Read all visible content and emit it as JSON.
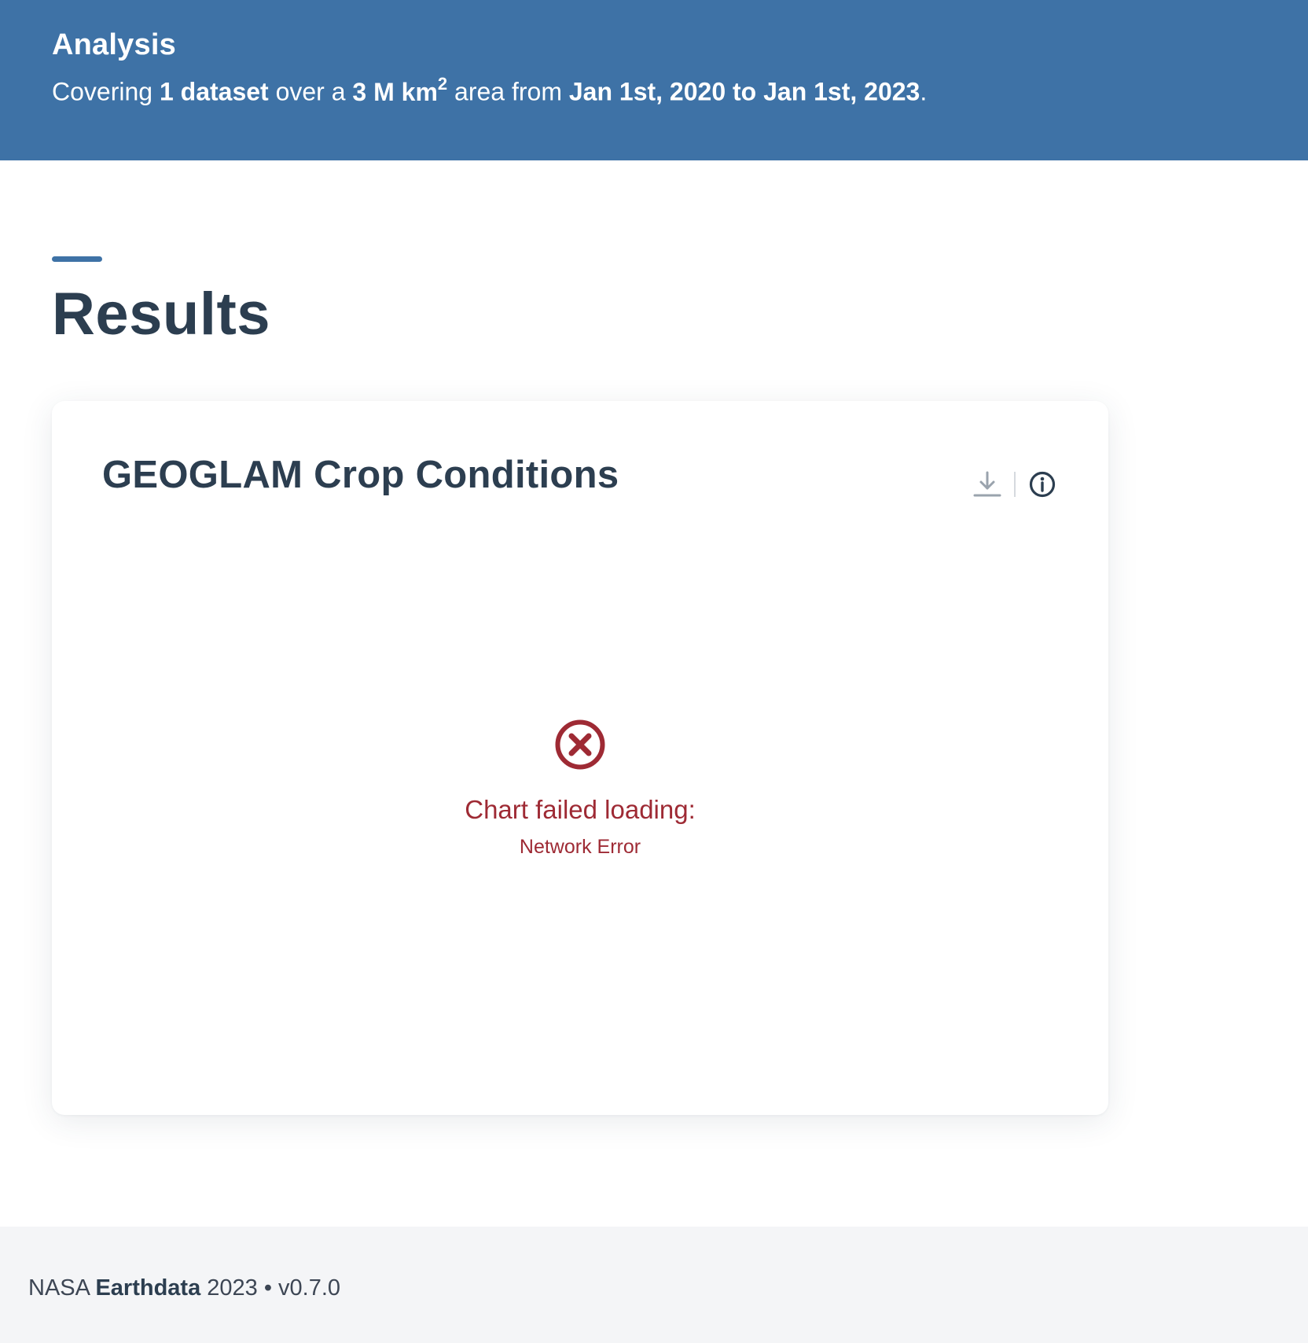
{
  "header": {
    "title": "Analysis",
    "subtitle": {
      "prefix": "Covering ",
      "datasets": "1 dataset",
      "mid1": " over a ",
      "area": "3 M km",
      "area_exp": "2",
      "mid2": " area from ",
      "date_range": "Jan 1st, 2020 to Jan 1st, 2023",
      "suffix": "."
    },
    "background_color": "#3e72a6"
  },
  "results": {
    "heading": "Results"
  },
  "card": {
    "title": "GEOGLAM Crop Conditions",
    "actions": {
      "download_icon": "download-icon",
      "info_icon": "info-icon"
    },
    "error": {
      "icon": "error-circle-x-icon",
      "message": "Chart failed loading:",
      "detail": "Network Error",
      "color": "#9e2a34"
    }
  },
  "footer": {
    "org": "NASA ",
    "product": "Earthdata",
    "year_version": " 2023 • v0.7.0"
  }
}
